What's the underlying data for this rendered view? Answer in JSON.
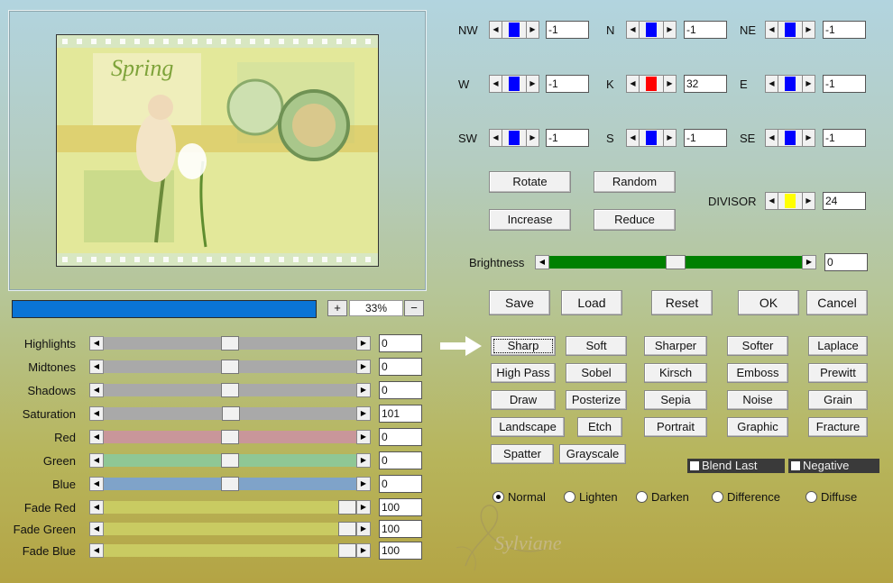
{
  "preview": {
    "zoom": "33%",
    "zoom_in": "+",
    "zoom_out": "−"
  },
  "adjust_sliders": [
    {
      "label": "Highlights",
      "value": "0",
      "color": "#a9a9a9",
      "thumb": 0.5
    },
    {
      "label": "Midtones",
      "value": "0",
      "color": "#a9a9a9",
      "thumb": 0.5
    },
    {
      "label": "Shadows",
      "value": "0",
      "color": "#a9a9a9",
      "thumb": 0.5
    },
    {
      "label": "Saturation",
      "value": "101",
      "color": "#a9a9a9",
      "thumb": 0.505
    },
    {
      "label": "Red",
      "value": "0",
      "color": "#c9969a",
      "thumb": 0.5
    },
    {
      "label": "Green",
      "value": "0",
      "color": "#8fc795",
      "thumb": 0.5
    },
    {
      "label": "Blue",
      "value": "0",
      "color": "#7fa3c9",
      "thumb": 0.5
    },
    {
      "label": "Fade Red",
      "value": "100",
      "color": "#c9cb62",
      "thumb": 1.0
    },
    {
      "label": "Fade Green",
      "value": "100",
      "color": "#c9cb62",
      "thumb": 1.0
    },
    {
      "label": "Fade Blue",
      "value": "100",
      "color": "#c9cb62",
      "thumb": 1.0
    }
  ],
  "matrix": [
    {
      "label": "NW",
      "value": "-1",
      "color": "#0000ff"
    },
    {
      "label": "N",
      "value": "-1",
      "color": "#0000ff"
    },
    {
      "label": "NE",
      "value": "-1",
      "color": "#0000ff"
    },
    {
      "label": "W",
      "value": "-1",
      "color": "#0000ff"
    },
    {
      "label": "K",
      "value": "32",
      "color": "#ff0000"
    },
    {
      "label": "E",
      "value": "-1",
      "color": "#0000ff"
    },
    {
      "label": "SW",
      "value": "-1",
      "color": "#0000ff"
    },
    {
      "label": "S",
      "value": "-1",
      "color": "#0000ff"
    },
    {
      "label": "SE",
      "value": "-1",
      "color": "#0000ff"
    }
  ],
  "divisor": {
    "label": "DIVISOR",
    "value": "24",
    "color": "#ffff00"
  },
  "matrix_buttons": {
    "rotate": "Rotate",
    "random": "Random",
    "increase": "Increase",
    "reduce": "Reduce"
  },
  "brightness": {
    "label": "Brightness",
    "value": "0",
    "color": "#008000"
  },
  "actions": {
    "save": "Save",
    "load": "Load",
    "reset": "Reset",
    "ok": "OK",
    "cancel": "Cancel"
  },
  "presets": [
    "Sharp",
    "Soft",
    "Sharper",
    "Softer",
    "Laplace",
    "High Pass",
    "Sobel",
    "Kirsch",
    "Emboss",
    "Prewitt",
    "Draw",
    "Posterize",
    "Sepia",
    "Noise",
    "Grain",
    "Landscape",
    "Etch",
    "Portrait",
    "Graphic",
    "Fracture",
    "Spatter",
    "Grayscale"
  ],
  "options": {
    "blend_last": "Blend Last",
    "negative": "Negative"
  },
  "blend_modes": [
    {
      "label": "Normal",
      "selected": true
    },
    {
      "label": "Lighten",
      "selected": false
    },
    {
      "label": "Darken",
      "selected": false
    },
    {
      "label": "Difference",
      "selected": false
    },
    {
      "label": "Diffuse",
      "selected": false
    }
  ]
}
